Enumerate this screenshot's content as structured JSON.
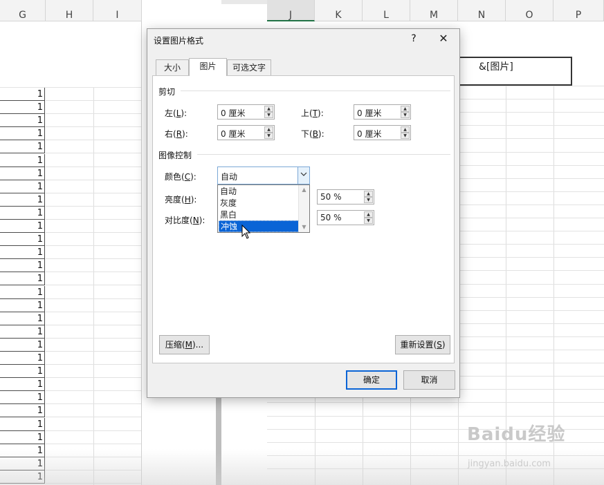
{
  "sheet": {
    "left_columns": [
      "G",
      "H",
      "I"
    ],
    "right_columns": [
      "J",
      "K",
      "L",
      "M",
      "N",
      "O",
      "P"
    ],
    "selected_column": "J",
    "cell_value": "1",
    "header_field_text": "&[图片]",
    "watermark_brand": "Baidu经验",
    "watermark_url": "jingyan.baidu.com"
  },
  "dialog": {
    "title": "设置图片格式",
    "help_label": "?",
    "close_label": "✕",
    "tabs": [
      {
        "label": "大小",
        "active": false
      },
      {
        "label": "图片",
        "active": true
      },
      {
        "label": "可选文字",
        "active": false
      }
    ],
    "crop": {
      "section_label": "剪切",
      "left_label": "左(",
      "left_key": "L",
      "left_value": "0 厘米",
      "right_label": "右(",
      "right_key": "R",
      "right_value": "0 厘米",
      "top_label": "上(",
      "top_key": "T",
      "top_value": "0 厘米",
      "bottom_label": "下(",
      "bottom_key": "B",
      "bottom_value": "0 厘米"
    },
    "image_control": {
      "section_label": "图像控制",
      "color_label": "颜色(",
      "color_key": "C",
      "color_value": "自动",
      "color_options": [
        "自动",
        "灰度",
        "黑白",
        "冲蚀"
      ],
      "color_highlighted": "冲蚀",
      "brightness_label": "亮度(",
      "brightness_key": "H",
      "brightness_value": "50 %",
      "contrast_label": "对比度(",
      "contrast_key": "N",
      "contrast_value": "50 %"
    },
    "compress_label": "压缩(",
    "compress_key": "M",
    "compress_suffix": ")...",
    "reset_label": "重新设置(",
    "reset_key": "S",
    "ok_label": "确定",
    "cancel_label": "取消"
  },
  "colors": {
    "accent": "#0a64d6",
    "excel_green": "#217346",
    "dialog_bg": "#f0f0f0"
  }
}
